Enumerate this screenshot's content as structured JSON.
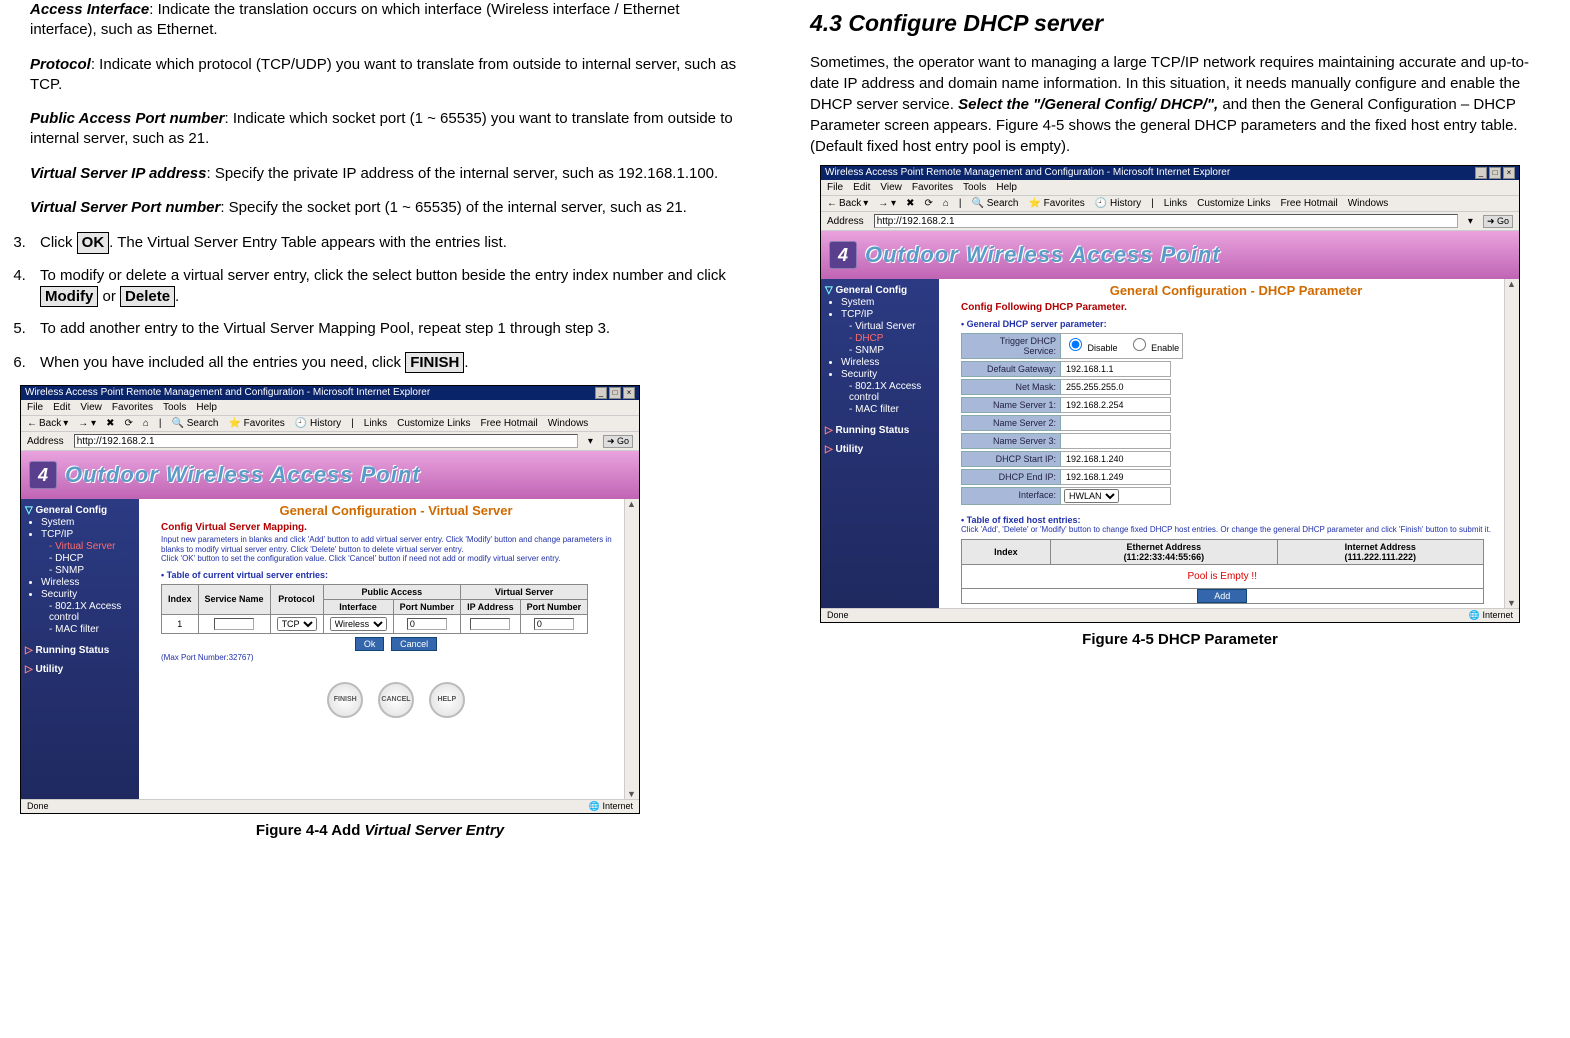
{
  "left": {
    "p1": {
      "b": "Access Interface",
      "t": ": Indicate the translation occurs on which interface (Wireless interface / Ethernet interface), such as Ethernet."
    },
    "p2": {
      "b": "Protocol",
      "t": ": Indicate which protocol (TCP/UDP) you want to translate from outside to internal server, such as TCP."
    },
    "p3": {
      "b": "Public Access Port number",
      "t": ": Indicate which socket port (1 ~ 65535) you want to translate from outside to internal server, such as 21."
    },
    "p4": {
      "b": "Virtual Server IP address",
      "t": ": Specify the private IP address of the internal server, such as 192.168.1.100."
    },
    "p5": {
      "b": "Virtual Server Port number",
      "t": ": Specify the socket port (1 ~ 65535) of the internal server, such as 21."
    },
    "li3a": "Click ",
    "li3b": ". The Virtual Server Entry Table appears with the entries list.",
    "li4a": "To modify or delete a virtual server entry, click the select button beside the entry index number and click ",
    "li4b": " or ",
    "li4c": ".",
    "li5": "To add another entry to the Virtual Server Mapping Pool, repeat step 1 through step 3.",
    "li6a": "When you have included all the entries you need, click ",
    "li6b": ".",
    "btn_ok": "OK",
    "btn_mod": "Modify",
    "btn_del": "Delete",
    "btn_fin": "FINISH",
    "caption": "Figure 4-4     Add ",
    "caption_i": "Virtual Server Entry"
  },
  "right": {
    "h": "4.3    Configure DHCP server",
    "p_a": "Sometimes, the operator want to managing a large TCP/IP network requires maintaining accurate and up-to-date IP address and domain name information. In this situation, it needs manually configure and enable the DHCP server service. ",
    "p_b": "Select the \"/General Config/ DHCP/\", ",
    "p_c": "and then the General Configuration – DHCP Parameter screen appears.  Figure 4-5 shows the general DHCP parameters and the fixed host entry table. (Default fixed host entry pool is empty).",
    "caption": "Figure 4-5   DHCP Parameter"
  },
  "ie": {
    "title": "Wireless Access Point Remote Management and Configuration - Microsoft Internet Explorer",
    "menu": [
      "File",
      "Edit",
      "View",
      "Favorites",
      "Tools",
      "Help"
    ],
    "back": "Back",
    "tb": [
      "Search",
      "Favorites",
      "History"
    ],
    "links": [
      "Links",
      "Customize Links",
      "Free Hotmail",
      "Windows"
    ],
    "addr_lbl": "Address",
    "url": "http://192.168.2.1",
    "go": "Go",
    "status_done": "Done",
    "status_net": "Internet",
    "banner": "Outdoor Wireless Access Point"
  },
  "sidebar": {
    "s1": "General Config",
    "items1": [
      "System",
      "TCP/IP"
    ],
    "vs": "Virtual Server",
    "sub1": [
      "DHCP",
      "SNMP"
    ],
    "items2": [
      "Wireless",
      "Security"
    ],
    "sub2": [
      "802.1X Access control",
      "MAC filter"
    ],
    "s2": "Running Status",
    "s3": "Utility"
  },
  "vs": {
    "title": "General Configuration - Virtual Server",
    "sub": "Config Virtual Server Mapping.",
    "help1": "Input new parameters in blanks and click 'Add' button to add virtual server entry. Click 'Modify' button and change parameters in blanks to modify virtual server entry. Click 'Delete' button to delete virtual server entry.",
    "help2": "Click 'OK' button to set the configuration value. Click 'Cancel' button if need not add or modify virtual server entry.",
    "tbl_title": "Table of current virtual server entries:",
    "hdr": {
      "index": "Index",
      "svc": "Service Name",
      "proto": "Protocol",
      "pa": "Public Access",
      "vs": "Virtual Server",
      "iface": "Interface",
      "port": "Port Number",
      "ip": "IP Address"
    },
    "row": {
      "idx": "1",
      "proto_opts": "TCP",
      "iface_opts": "Wireless",
      "port": "0",
      "vport": "0"
    },
    "ok": "Ok",
    "cancel": "Cancel",
    "note": "(Max Port Number:32767)",
    "rb": [
      "FINISH",
      "CANCEL",
      "HELP"
    ]
  },
  "dhcp": {
    "title": "General Configuration - DHCP Parameter",
    "sub": "Config Following DHCP Parameter.",
    "sect": "General DHCP server parameter:",
    "rows": [
      {
        "k": "Trigger DHCP Service:",
        "radio": true,
        "r1": "Disable",
        "r2": "Enable"
      },
      {
        "k": "Default Gateway:",
        "v": "192.168.1.1"
      },
      {
        "k": "Net Mask:",
        "v": "255.255.255.0"
      },
      {
        "k": "Name Server 1:",
        "v": "192.168.2.254"
      },
      {
        "k": "Name Server 2:",
        "v": ""
      },
      {
        "k": "Name Server 3:",
        "v": ""
      },
      {
        "k": "DHCP Start IP:",
        "v": "192.168.1.240"
      },
      {
        "k": "DHCP End IP:",
        "v": "192.168.1.249"
      },
      {
        "k": "Interface:",
        "sel": "HWLAN"
      }
    ],
    "tbl_title": "Table of fixed host entries:",
    "tbl_help": "Click 'Add', 'Delete' or 'Modify' button to change fixed DHCP host entries. Or change the general DHCP parameter and click 'Finish' button to submit it.",
    "th1": "Index",
    "th2": "Ethernet Address",
    "th2s": "(11:22:33:44:55:66)",
    "th3": "Internet Address",
    "th3s": "(111.222.111.222)",
    "empty": "Pool is Empty !!",
    "add": "Add"
  }
}
